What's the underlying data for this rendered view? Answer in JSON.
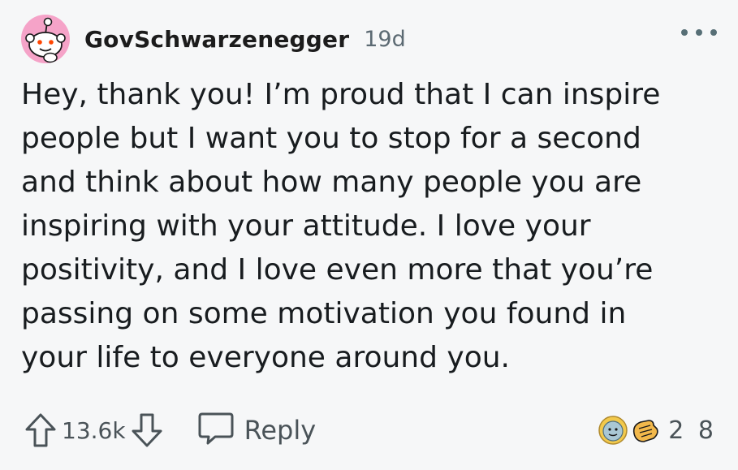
{
  "comment": {
    "username": "GovSchwarzenegger",
    "age": "19d",
    "body": "Hey, thank you! I’m proud that I can inspire\npeople but I want you to stop for a second\nand think about how many people you are\ninspiring with your attitude. I love your\npositivity, and I love even more that you’re\npassing on some motivation you found in\nyour life to everyone around you.",
    "score": "13.6k",
    "reply_label": "Reply",
    "award_count": "2 8"
  },
  "icons": {
    "avatar": "snoo-avatar-icon",
    "more": "more-options-icon",
    "upvote": "upvote-arrow-icon",
    "downvote": "downvote-arrow-icon",
    "reply": "speech-bubble-icon",
    "awards": [
      "wholesome-seal-award-icon",
      "bravo-hands-award-icon"
    ]
  },
  "colors": {
    "background": "#f6f7f8",
    "avatar_bg": "#f5a3c8",
    "text": "#181c1f",
    "meta": "#5c6a73"
  }
}
